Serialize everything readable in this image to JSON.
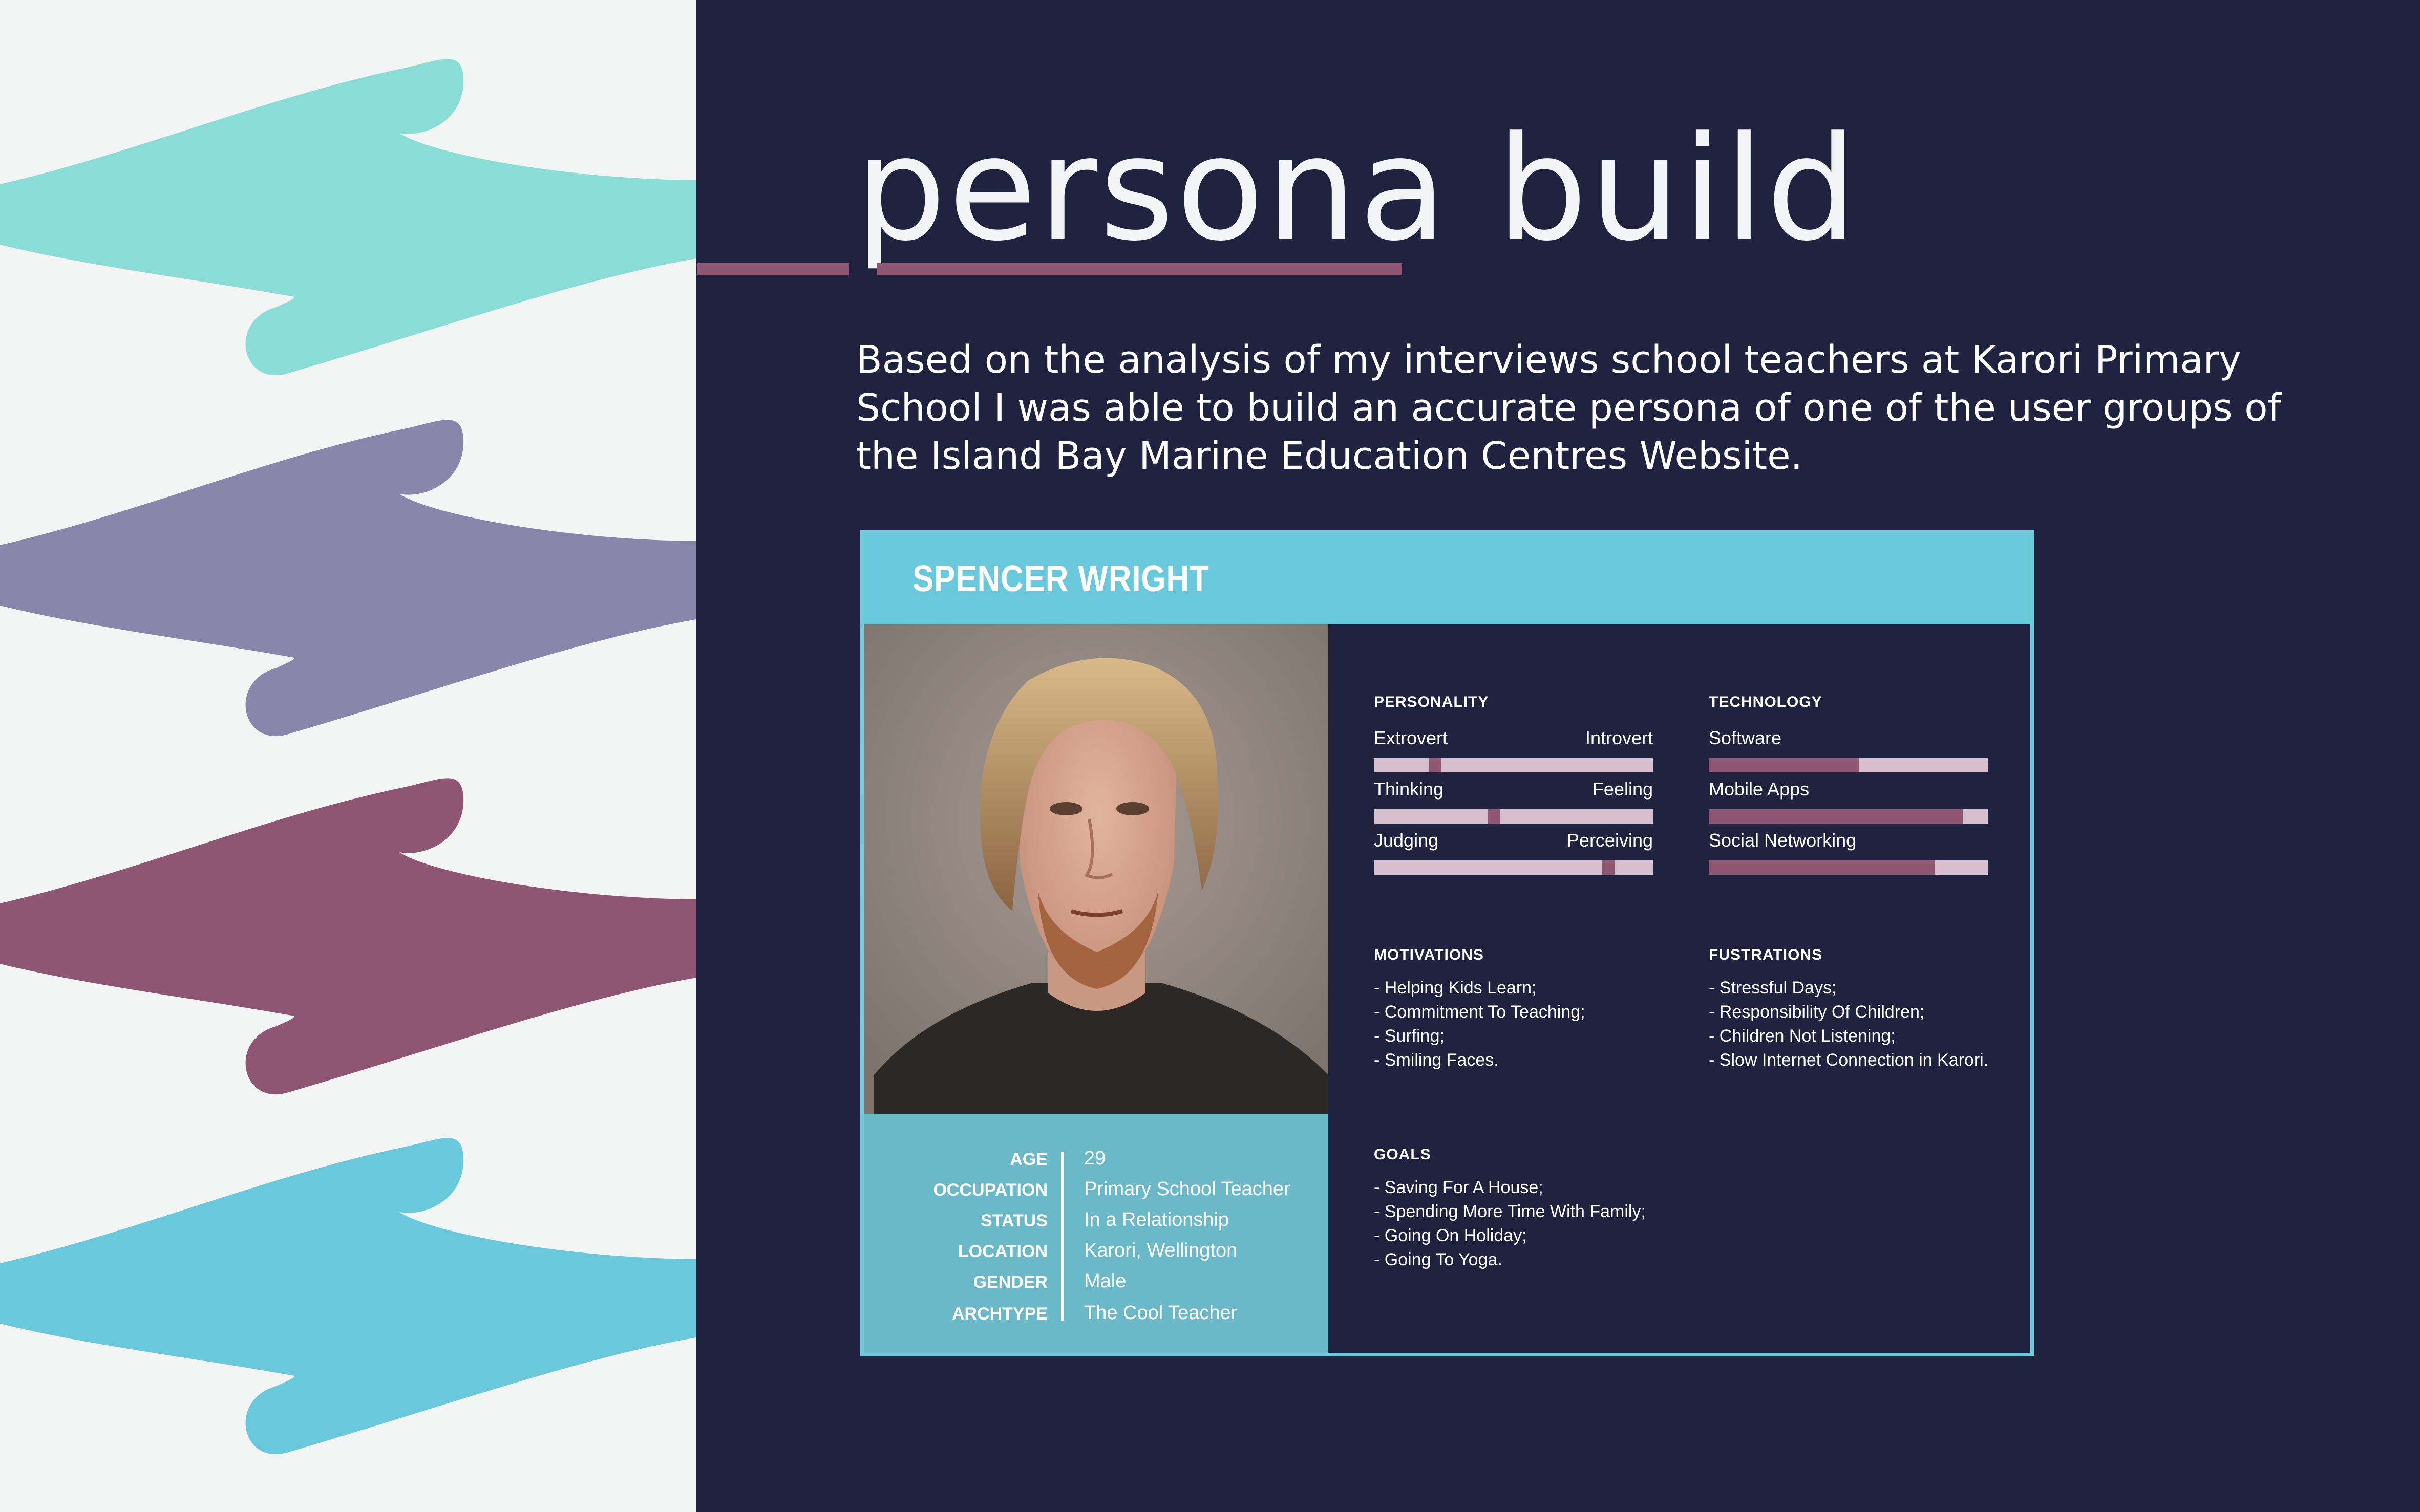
{
  "colors": {
    "left_background": "#f3f5f5",
    "right_background": "#1f2340",
    "teal": "#8adcd6",
    "lavender": "#8887ab",
    "plum": "#8e5673",
    "sky": "#6ac8dc",
    "bar_track": "#d8bfd0",
    "bar_fill": "#8e5673"
  },
  "decor": {
    "shapes": [
      {
        "name": "teal-wave-shape",
        "color": "#8adcd6"
      },
      {
        "name": "lavender-wave-shape",
        "color": "#8887ab"
      },
      {
        "name": "plum-wave-shape",
        "color": "#8e5673"
      },
      {
        "name": "sky-wave-shape",
        "color": "#6ac8dc"
      }
    ]
  },
  "header": {
    "title": "persona build"
  },
  "intro": {
    "text": "Based on the analysis of my interviews school teachers at Karori Primary School I was able to build an accurate persona of one of the user groups of the Island Bay Marine Education Centres Website."
  },
  "persona": {
    "name": "SPENCER WRIGHT",
    "photo_alt": "portrait-photo",
    "info": [
      {
        "label": "AGE",
        "value": "29"
      },
      {
        "label": "OCCUPATION",
        "value": "Primary School Teacher"
      },
      {
        "label": "STATUS",
        "value": "In a Relationship"
      },
      {
        "label": "LOCATION",
        "value": "Karori, Wellington"
      },
      {
        "label": "GENDER",
        "value": "Male"
      },
      {
        "label": "ARCHTYPE",
        "value": "The Cool Teacher"
      }
    ],
    "personality": {
      "heading": "PERSONALITY",
      "scales": [
        {
          "left": "Extrovert",
          "right": "Introvert",
          "position": 0.22
        },
        {
          "left": "Thinking",
          "right": "Feeling",
          "position": 0.43
        },
        {
          "left": "Judging",
          "right": "Perceiving",
          "position": 0.84
        }
      ]
    },
    "technology": {
      "heading": "TECHNOLOGY",
      "items": [
        {
          "label": "Software",
          "level": 0.54
        },
        {
          "label": "Mobile Apps",
          "level": 0.91
        },
        {
          "label": "Social Networking",
          "level": 0.81
        }
      ]
    },
    "motivations": {
      "heading": "MOTIVATIONS",
      "items": [
        "- Helping Kids Learn;",
        "- Commitment To Teaching;",
        "- Surfing;",
        "- Smiling Faces."
      ]
    },
    "frustrations": {
      "heading": "FUSTRATIONS",
      "items": [
        "- Stressful Days;",
        "- Responsibility Of Children;",
        "- Children Not Listening;",
        "- Slow Internet Connection in Karori."
      ]
    },
    "goals": {
      "heading": "GOALS",
      "items": [
        "- Saving For A House;",
        "- Spending More Time With Family;",
        "- Going On Holiday;",
        "- Going To Yoga."
      ]
    }
  }
}
